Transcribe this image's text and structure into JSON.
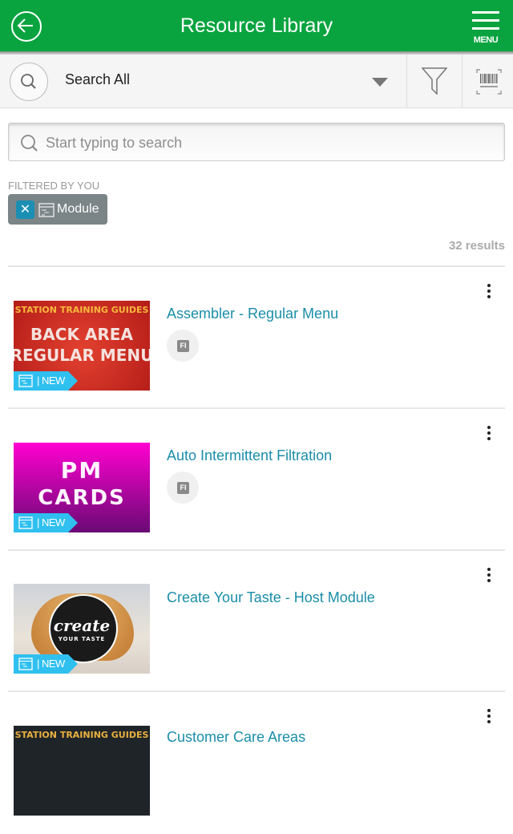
{
  "header": {
    "title": "Resource Library",
    "back_icon": "arrow-left-circle-icon",
    "menu_label": "MENU",
    "background_color": "#09a43f"
  },
  "toolbar": {
    "scope_label": "Search All",
    "search_icon": "search-icon",
    "filter_icon": "funnel-icon",
    "barcode_icon": "barcode-scan-icon"
  },
  "search": {
    "placeholder": "Start typing to search",
    "value": ""
  },
  "filters": {
    "label": "FILTERED BY YOU",
    "chips": [
      {
        "label": "Module",
        "remove_glyph": "✕",
        "icon": "module-icon"
      }
    ]
  },
  "results": {
    "count_text": "32 results"
  },
  "items": [
    {
      "title": "Assembler - Regular Menu",
      "badge": "FI",
      "tag": "| NEW",
      "thumb": {
        "line1": "STATION TRAINING GUIDES",
        "line2": "BACK AREA",
        "line3": "REGULAR MENU"
      }
    },
    {
      "title": "Auto Intermittent Filtration",
      "badge": "FI",
      "tag": "| NEW",
      "thumb": {
        "line1": "PM",
        "line2": "CARDS"
      }
    },
    {
      "title": "Create Your Taste - Host Module",
      "badge": null,
      "tag": "| NEW",
      "thumb": {
        "line1": "create",
        "line2": "YOUR TASTE"
      }
    },
    {
      "title": "Customer Care Areas",
      "thumb": {
        "line1": "STATION TRAINING GUIDES"
      }
    }
  ],
  "colors": {
    "accent_link": "#1a8ea8",
    "new_tag": "#2fc0ef",
    "chip_bg": "#7b8487",
    "chip_close": "#1b8fb3"
  }
}
